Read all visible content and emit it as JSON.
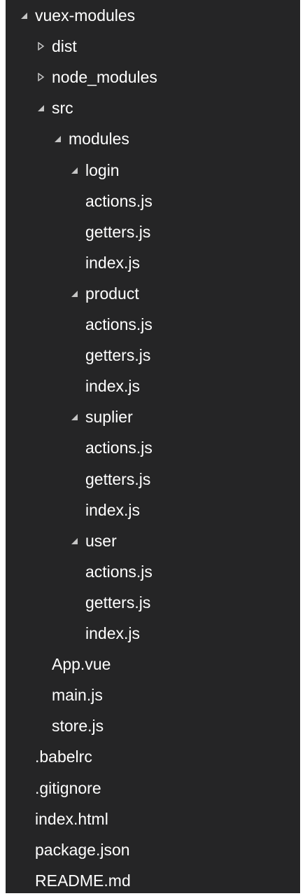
{
  "explorer": {
    "items": [
      {
        "label": "vuex-modules",
        "type": "folder",
        "expanded": true,
        "depth": 0
      },
      {
        "label": "dist",
        "type": "folder",
        "expanded": false,
        "depth": 1
      },
      {
        "label": "node_modules",
        "type": "folder",
        "expanded": false,
        "depth": 1
      },
      {
        "label": "src",
        "type": "folder",
        "expanded": true,
        "depth": 1
      },
      {
        "label": "modules",
        "type": "folder",
        "expanded": true,
        "depth": 2
      },
      {
        "label": "login",
        "type": "folder",
        "expanded": true,
        "depth": 3
      },
      {
        "label": "actions.js",
        "type": "file",
        "depth": 4
      },
      {
        "label": "getters.js",
        "type": "file",
        "depth": 4
      },
      {
        "label": "index.js",
        "type": "file",
        "depth": 4
      },
      {
        "label": "product",
        "type": "folder",
        "expanded": true,
        "depth": 3
      },
      {
        "label": "actions.js",
        "type": "file",
        "depth": 4
      },
      {
        "label": "getters.js",
        "type": "file",
        "depth": 4
      },
      {
        "label": "index.js",
        "type": "file",
        "depth": 4
      },
      {
        "label": "suplier",
        "type": "folder",
        "expanded": true,
        "depth": 3
      },
      {
        "label": "actions.js",
        "type": "file",
        "depth": 4
      },
      {
        "label": "getters.js",
        "type": "file",
        "depth": 4
      },
      {
        "label": "index.js",
        "type": "file",
        "depth": 4
      },
      {
        "label": "user",
        "type": "folder",
        "expanded": true,
        "depth": 3
      },
      {
        "label": "actions.js",
        "type": "file",
        "depth": 4
      },
      {
        "label": "getters.js",
        "type": "file",
        "depth": 4
      },
      {
        "label": "index.js",
        "type": "file",
        "depth": 4
      },
      {
        "label": "App.vue",
        "type": "file",
        "depth": 2
      },
      {
        "label": "main.js",
        "type": "file",
        "depth": 2
      },
      {
        "label": "store.js",
        "type": "file",
        "depth": 2
      },
      {
        "label": ".babelrc",
        "type": "file",
        "depth": 1
      },
      {
        "label": ".gitignore",
        "type": "file",
        "depth": 1
      },
      {
        "label": "index.html",
        "type": "file",
        "depth": 1
      },
      {
        "label": "package.json",
        "type": "file",
        "depth": 1
      },
      {
        "label": "README.md",
        "type": "file",
        "depth": 1
      }
    ]
  },
  "colors": {
    "panel_background": "#252526",
    "text": "#ffffff",
    "twisty": "#c5c5c5"
  }
}
